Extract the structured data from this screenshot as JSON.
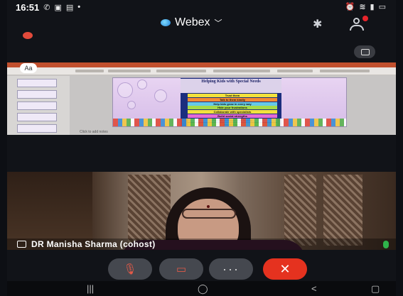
{
  "status_bar": {
    "time": "16:51",
    "left_icons": [
      "whatsapp-icon",
      "screen-record-icon",
      "gallery-icon",
      "notification-dot-icon"
    ],
    "right_icons": [
      "alarm-icon",
      "wifi-icon",
      "signal-icon",
      "battery-icon"
    ]
  },
  "header": {
    "app_name": "Webex",
    "chevron": "﹀",
    "bluetooth_glyph": "✱"
  },
  "shared_screen": {
    "cursor_badge": "Aa",
    "slide_title": "Helping Kids with Special Needs",
    "slide_lines": [
      "Trust them",
      "Talk to them kindly",
      "Help kids grow in every way",
      "Hide your frustrations",
      "Collaborate with specialists",
      "Build social strengths",
      "Provide structure and routine",
      "Reward them"
    ],
    "row_colors": [
      "#f2e23d",
      "#f58a33",
      "#67c9e8",
      "#a6d949",
      "#f2e23d",
      "#e36ad6",
      "#67c9e8",
      "#a6d949"
    ],
    "status_text": "Click to add notes"
  },
  "participant": {
    "name": "DR Manisha Sharma (cohost)",
    "mic_status_color": "#2fb34a"
  },
  "controls": {
    "mute_glyph": "🎙",
    "video_glyph": "▭",
    "more_glyph": "···",
    "end_glyph": "✕"
  },
  "nav": {
    "recents": "|||",
    "home": "◯",
    "back": "<",
    "screenshot": "▢"
  }
}
